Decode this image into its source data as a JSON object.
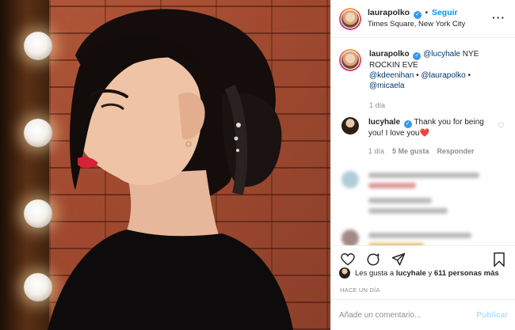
{
  "post": {
    "username": "laurapolko",
    "follow_label": "Seguir",
    "location": "Times Square, New York City"
  },
  "caption": {
    "username": "laurapolko",
    "mention1": "@lucyhale",
    "text": "NYE ROCKIN EVE",
    "mention2": "@kdeenihan",
    "mention3": "@laurapolko",
    "mention4": "@micaela",
    "time": "1 día"
  },
  "reply": {
    "username": "lucyhale",
    "text": "Thank you for being you! I love you",
    "emoji": "❤️",
    "time": "1 día",
    "likes": "5 Me gusta",
    "reply_label": "Responder"
  },
  "likes_line": {
    "prefix": "Les gusta a",
    "user": "lucyhale",
    "connector": "y",
    "count": "611 personas más"
  },
  "timestamp": "HACE UN DÍA",
  "comment_box": {
    "placeholder": "Añade un comentario...",
    "publish_label": "Publicar"
  },
  "colors": {
    "accent": "#0095f6",
    "verified": "#3897f0"
  }
}
